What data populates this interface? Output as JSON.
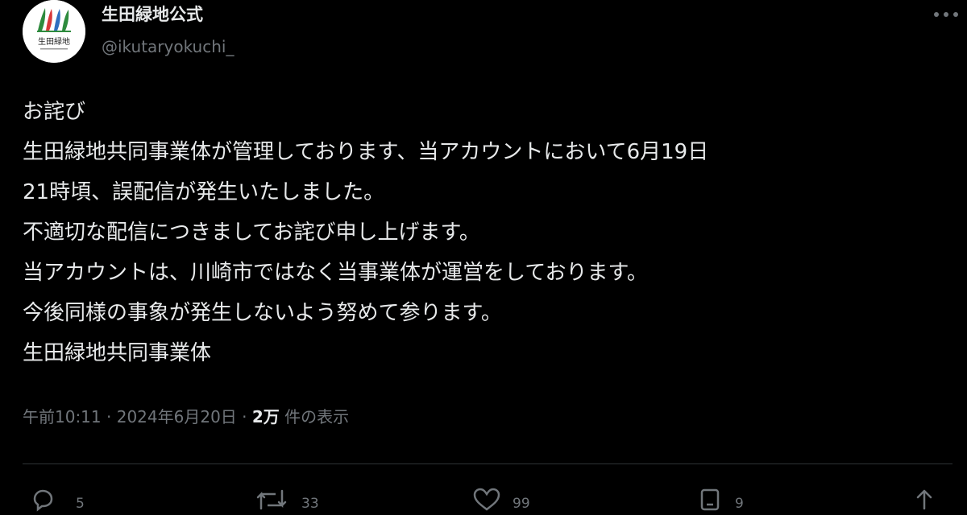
{
  "account": {
    "display_name": "生田緑地公式",
    "handle": "@ikutaryokuchi_",
    "avatar_text": "生田緑地"
  },
  "tweet": {
    "lines": [
      "お詫び",
      "生田緑地共同事業体が管理しております、当アカウントにおいて6月19日",
      "21時頃、誤配信が発生いたしました。",
      "不適切な配信につきましてお詫び申し上げます。",
      "当アカウントは、川崎市ではなく当事業体が運営をしております。",
      "今後同様の事象が発生しないよう努めて参ります。",
      "生田緑地共同事業体"
    ]
  },
  "meta": {
    "time": "午前10:11",
    "separator": "·",
    "date": "2024年6月20日",
    "views_count": "2万",
    "views_label": "件の表示"
  },
  "actions": {
    "reply_count": "5",
    "retweet_count": "33",
    "like_count": "99",
    "bookmark_count": "9"
  },
  "icons": {
    "more": "more-horizontal-icon",
    "reply": "reply-icon",
    "retweet": "retweet-icon",
    "like": "heart-icon",
    "bookmark": "bookmark-icon",
    "share": "share-icon"
  },
  "colors": {
    "background": "#000000",
    "text": "#e7e9ea",
    "secondary_text": "#71767b",
    "divider": "#2f3336",
    "logo_green": "#2e8b3e",
    "logo_red": "#d9383a",
    "logo_blue": "#2f6fc0"
  }
}
